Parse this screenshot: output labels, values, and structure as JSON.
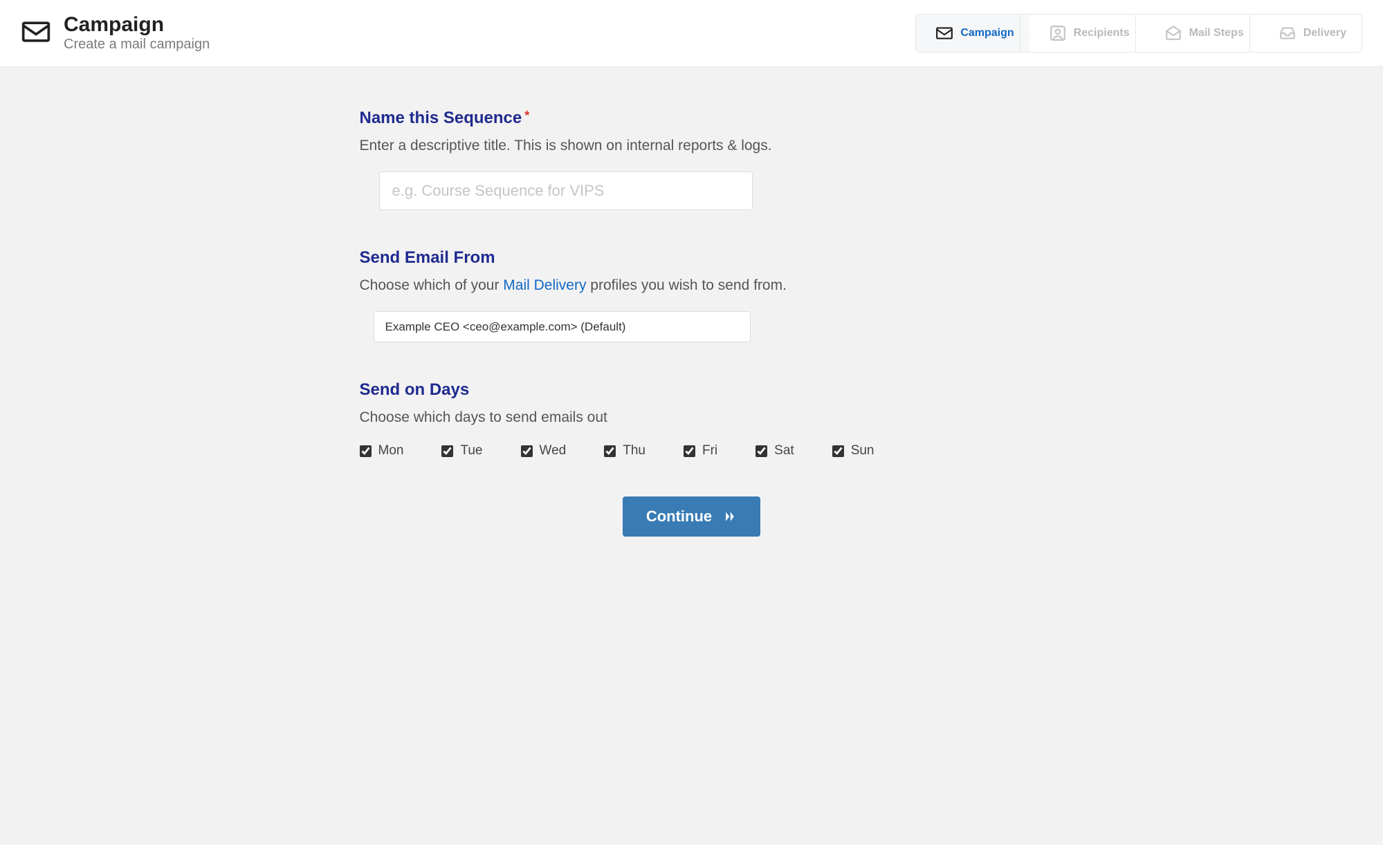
{
  "header": {
    "title": "Campaign",
    "subtitle": "Create a mail campaign"
  },
  "steps": [
    {
      "label": "Campaign",
      "icon": "envelope-icon",
      "active": true
    },
    {
      "label": "Recipients",
      "icon": "user-square-icon",
      "active": false
    },
    {
      "label": "Mail Steps",
      "icon": "envelope-open-icon",
      "active": false
    },
    {
      "label": "Delivery",
      "icon": "inbox-icon",
      "active": false
    }
  ],
  "sections": {
    "name": {
      "title": "Name this Sequence",
      "required_mark": "*",
      "desc": "Enter a descriptive title. This is shown on internal reports & logs.",
      "placeholder": "e.g. Course Sequence for VIPS",
      "value": ""
    },
    "from": {
      "title": "Send Email From",
      "desc_pre": "Choose which of your ",
      "desc_link": "Mail Delivery",
      "desc_post": " profiles you wish to send from.",
      "selected": "Example CEO <ceo@example.com> (Default)"
    },
    "days": {
      "title": "Send on Days",
      "desc": "Choose which days to send emails out",
      "items": [
        {
          "label": "Mon",
          "checked": true
        },
        {
          "label": "Tue",
          "checked": true
        },
        {
          "label": "Wed",
          "checked": true
        },
        {
          "label": "Thu",
          "checked": true
        },
        {
          "label": "Fri",
          "checked": true
        },
        {
          "label": "Sat",
          "checked": true
        },
        {
          "label": "Sun",
          "checked": true
        }
      ]
    }
  },
  "buttons": {
    "continue": "Continue"
  }
}
